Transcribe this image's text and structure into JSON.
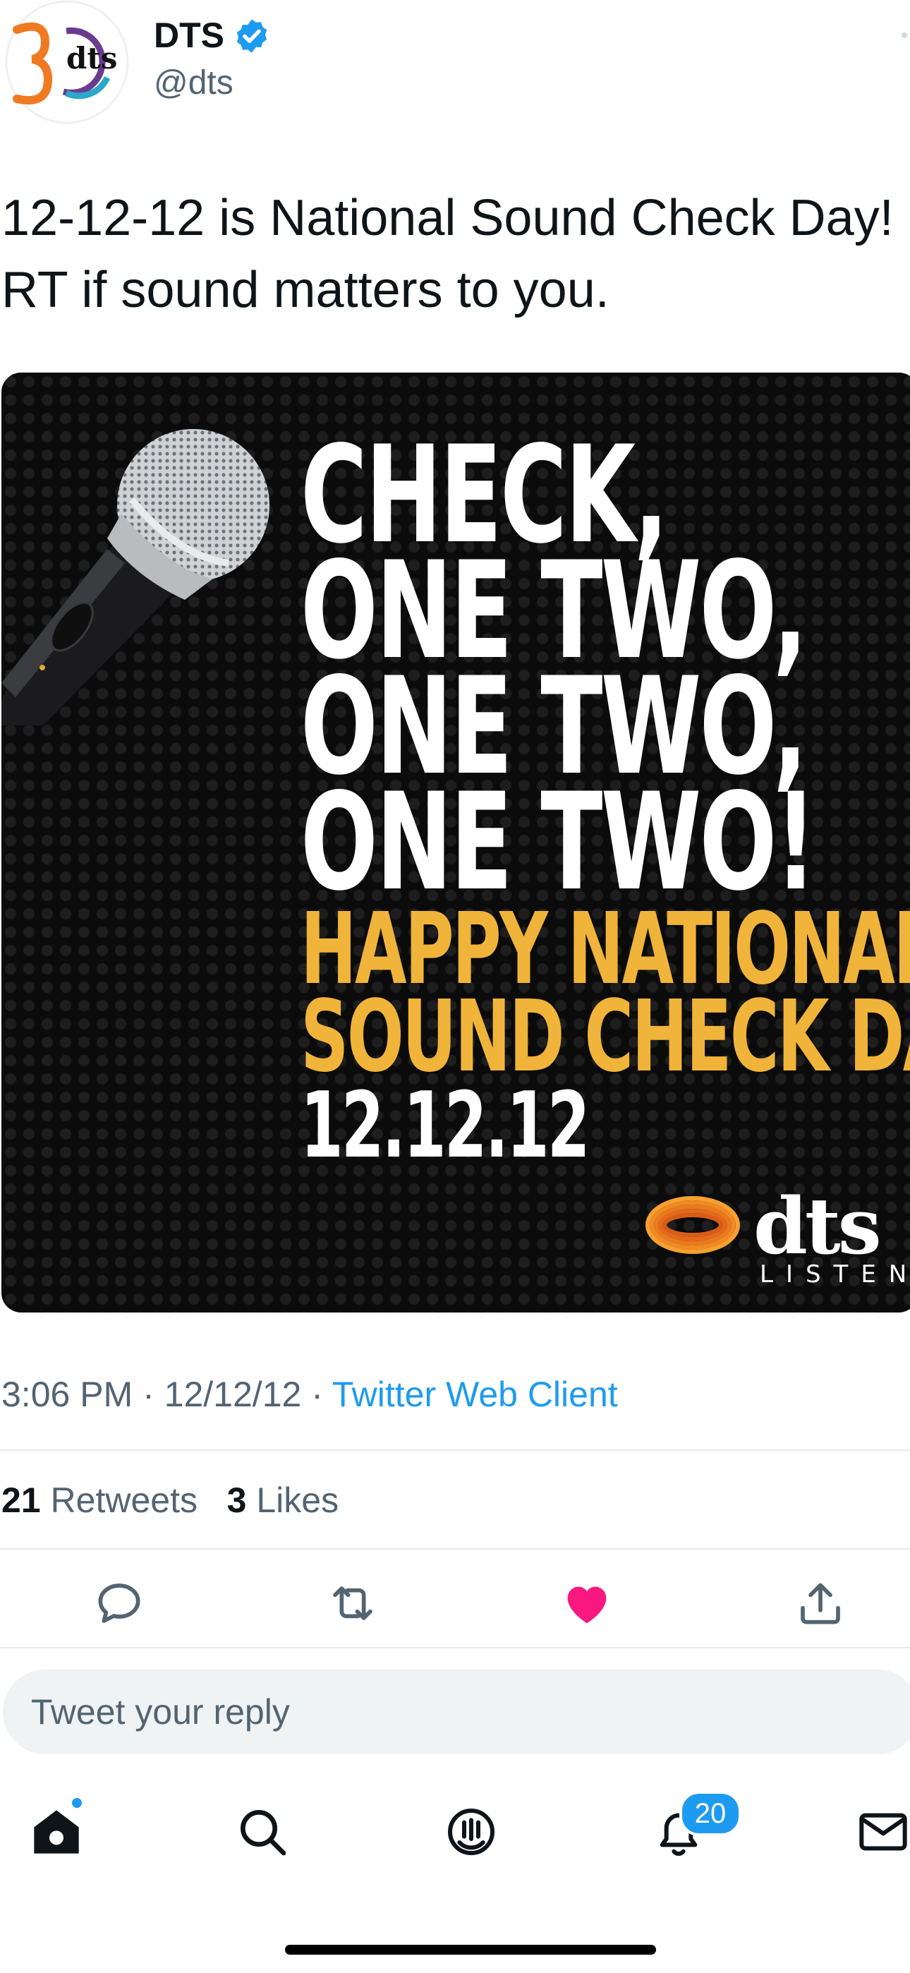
{
  "tweet": {
    "author_name": "DTS",
    "handle": "@dts",
    "avatar_logo": "dts",
    "text": "12-12-12 is National Sound Check Day!\nRT if sound matters to you.",
    "media": {
      "lines_white": [
        "CHECK,",
        "ONE TWO,",
        "ONE TWO,",
        "ONE TWO!"
      ],
      "lines_gold": [
        "HAPPY NATIONAL",
        "SOUND CHECK DAY!"
      ],
      "date": "12.12.12",
      "brand": "dts",
      "brand_tagline": "LISTEN"
    },
    "time": "3:06 PM",
    "date": "12/12/12",
    "separator": "·",
    "source": "Twitter Web Client",
    "retweets_count": "21",
    "retweets_label": "Retweets",
    "likes_count": "3",
    "likes_label": "Likes"
  },
  "actions": {
    "reply_icon": "reply-icon",
    "retweet_icon": "retweet-icon",
    "like_icon": "heart-icon",
    "share_icon": "share-icon",
    "liked_color": "#f91880"
  },
  "reply": {
    "placeholder": "Tweet your reply"
  },
  "tabbar": {
    "icons": [
      "home-icon",
      "search-icon",
      "spaces-icon",
      "bell-icon",
      "mail-icon"
    ],
    "notifications_badge": "20"
  },
  "colors": {
    "accent": "#1d9bf0",
    "gold": "#f0b43a"
  }
}
